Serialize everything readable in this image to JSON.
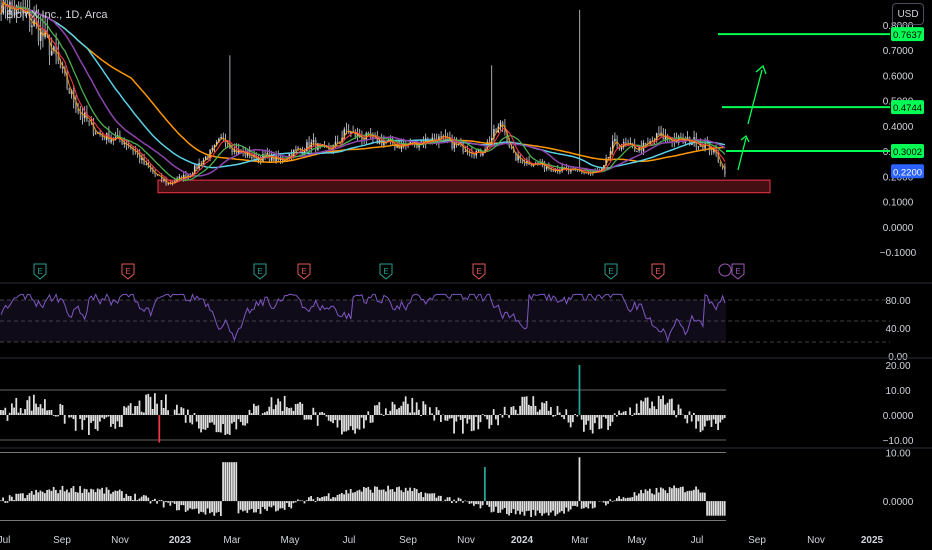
{
  "header": {
    "symbol_line": "BiomX Inc., 1D, Arca",
    "currency_button": "USD"
  },
  "colors": {
    "background": "#000000",
    "up_candle": "#d1d4dc",
    "down_candle": "#d1d4dc",
    "orange_ma": "#ff9800",
    "cyan_ma": "#5ad1e6",
    "purple_ma": "#8e44ad",
    "green_ma": "#4caf50",
    "red_ma": "#f23645",
    "level_line": "#00ff55",
    "rsi_line": "#7e57c2",
    "support_box": "#f23645"
  },
  "chart_data": [
    {
      "type": "line",
      "panel": "price",
      "yaxis_ticks": [
        "0.8000",
        "0.7000",
        "0.6000",
        "0.5000",
        "0.4000",
        "0.3000",
        "0.2000",
        "0.1000",
        "0.0000",
        "−0.1000"
      ],
      "ylim": [
        -0.1,
        0.8
      ],
      "xaxis_ticks": [
        "Jul",
        "Sep",
        "Nov",
        "2023",
        "Mar",
        "May",
        "Jul",
        "Sep",
        "Nov",
        "2024",
        "Mar",
        "May",
        "Jul",
        "Sep",
        "Nov",
        "2025"
      ],
      "price_close": [
        0.9,
        0.86,
        0.84,
        0.8,
        0.74,
        0.66,
        0.55,
        0.46,
        0.4,
        0.36,
        0.35,
        0.34,
        0.3,
        0.24,
        0.2,
        0.17,
        0.19,
        0.21,
        0.26,
        0.3,
        0.36,
        0.3,
        0.29,
        0.27,
        0.28,
        0.26,
        0.29,
        0.31,
        0.33,
        0.3,
        0.32,
        0.38,
        0.36,
        0.35,
        0.34,
        0.33,
        0.32,
        0.33,
        0.34,
        0.35,
        0.34,
        0.32,
        0.31,
        0.29,
        0.35,
        0.41,
        0.28,
        0.26,
        0.25,
        0.24,
        0.23,
        0.22,
        0.22,
        0.21,
        0.22,
        0.33,
        0.32,
        0.31,
        0.32,
        0.36,
        0.35,
        0.34,
        0.34,
        0.33,
        0.3,
        0.22
      ],
      "level_labels": [
        {
          "label": "0.7637",
          "value": 0.7637,
          "style": "green"
        },
        {
          "label": "0.4744",
          "value": 0.4744,
          "style": "green"
        },
        {
          "label": "0.3002",
          "value": 0.3002,
          "style": "green"
        },
        {
          "label": "0.2200",
          "value": 0.22,
          "style": "blue"
        }
      ],
      "support_zone": [
        0.135,
        0.185
      ],
      "earnings_markers": [
        "E",
        "E",
        "E",
        "E",
        "E",
        "E",
        "E",
        "E",
        "E"
      ]
    },
    {
      "type": "line",
      "panel": "rsi",
      "yaxis_ticks": [
        "80.00",
        "40.00",
        "0.00"
      ],
      "ylim": [
        0,
        100
      ],
      "upper_band": 80,
      "lower_band": 20,
      "mid_band": 50
    },
    {
      "type": "bar",
      "panel": "oscillator_1",
      "yaxis_ticks": [
        "20.00",
        "10.00",
        "0.0000",
        "−10.00"
      ],
      "ylim": [
        -12,
        22
      ]
    },
    {
      "type": "bar",
      "panel": "oscillator_2",
      "yaxis_ticks": [
        "10.00",
        "0.0000"
      ],
      "ylim": [
        -4,
        10
      ]
    }
  ]
}
